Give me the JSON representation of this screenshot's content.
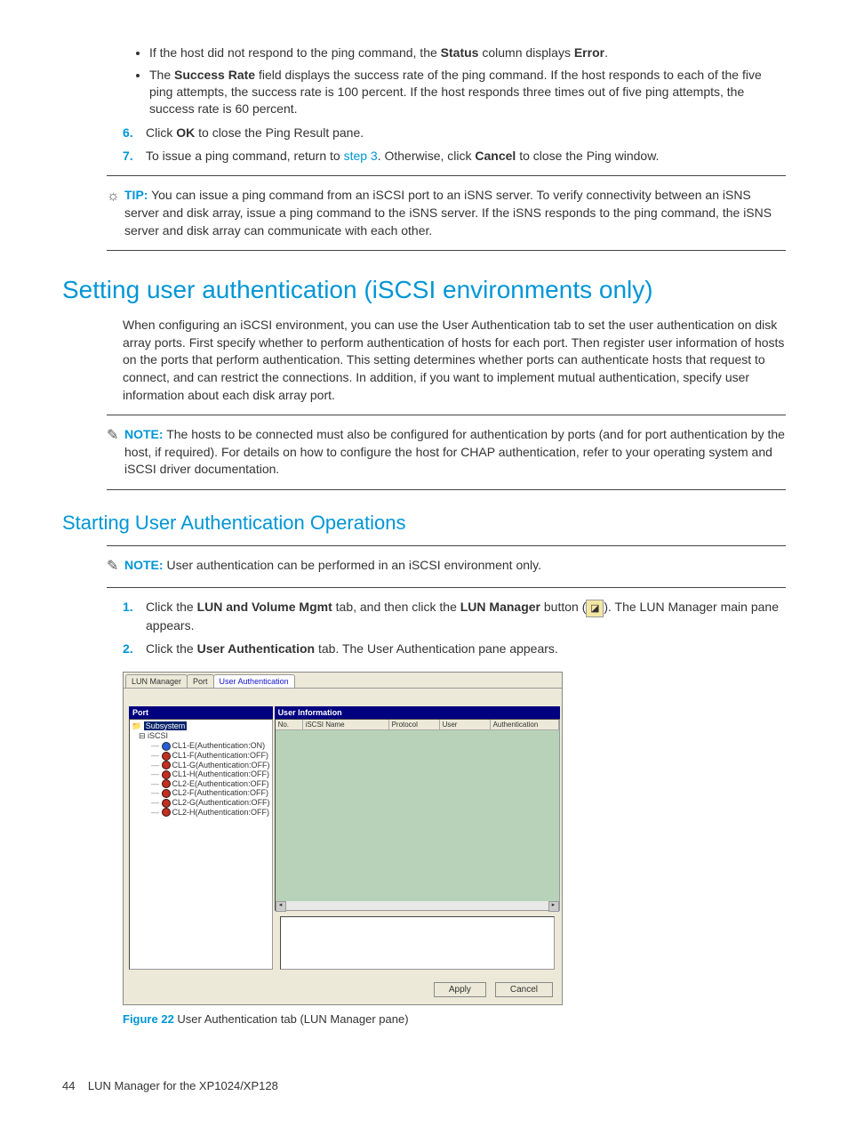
{
  "bullets": [
    {
      "pre": "If the host did not respond to the ping command, the ",
      "b1": "Status",
      "mid": " column displays ",
      "b2": "Error",
      "post": "."
    },
    {
      "pre": "The ",
      "b1": "Success Rate",
      "mid": "",
      "b2": "",
      "post": " field displays the success rate of the ping command. If the host responds to each of the five ping attempts, the success rate is 100 percent. If the host responds three times out of five ping attempts, the success rate is 60 percent."
    }
  ],
  "steps_top": [
    {
      "num": "6.",
      "pre": "Click ",
      "b1": "OK",
      "post": " to close the Ping Result pane."
    },
    {
      "num": "7.",
      "pre": "To issue a ping command, return to ",
      "link": "step 3",
      "mid": ". Otherwise, click ",
      "b1": "Cancel",
      "post": " to close the Ping window."
    }
  ],
  "tip": {
    "label": "TIP:",
    "text": "You can issue a ping command from an iSCSI port to an iSNS server. To verify connectivity between an iSNS server and disk array, issue a ping command to the iSNS server. If the iSNS responds to the ping command, the iSNS server and disk array can communicate with each other."
  },
  "heading1": "Setting user authentication (iSCSI environments only)",
  "para1": "When configuring an iSCSI environment, you can use the User Authentication tab to set the user authentication on disk array ports. First specify whether to perform authentication of hosts for each port. Then register user information of hosts on the ports that perform authentication. This setting determines whether ports can authenticate hosts that request to connect, and can restrict the connections. In addition, if you want to implement mutual authentication, specify user information about each disk array port.",
  "note1": {
    "label": "NOTE:",
    "text": "The hosts to be connected must also be configured for authentication by ports (and for port authentication by the host, if required). For details on how to configure the host for CHAP authentication, refer to your operating system and iSCSI driver documentation."
  },
  "heading2": "Starting User Authentication Operations",
  "note2": {
    "label": "NOTE:",
    "text": "User authentication can be performed in an iSCSI environment only."
  },
  "steps_main": [
    {
      "num": "1.",
      "pre": "Click the ",
      "b1": "LUN and Volume Mgmt",
      "mid": " tab, and then click the ",
      "b2": "LUN Manager",
      "post1": " button (",
      "post2": "). The LUN Manager main pane appears."
    },
    {
      "num": "2.",
      "pre": "Click the ",
      "b1": "User Authentication",
      "mid": " tab. The User Authentication pane appears.",
      "b2": "",
      "post1": "",
      "post2": ""
    }
  ],
  "figure": {
    "tabs": [
      "LUN Manager",
      "Port",
      "User Authentication"
    ],
    "active_tab_index": 2,
    "left_title": "Port",
    "right_title": "User Information",
    "tree": {
      "root": "Subsystem",
      "child": "iSCSI",
      "leaves": [
        {
          "name": "CL1-E(Authentication:ON)",
          "on": true
        },
        {
          "name": "CL1-F(Authentication:OFF)",
          "on": false
        },
        {
          "name": "CL1-G(Authentication:OFF)",
          "on": false
        },
        {
          "name": "CL1-H(Authentication:OFF)",
          "on": false
        },
        {
          "name": "CL2-E(Authentication:OFF)",
          "on": false
        },
        {
          "name": "CL2-F(Authentication:OFF)",
          "on": false
        },
        {
          "name": "CL2-G(Authentication:OFF)",
          "on": false
        },
        {
          "name": "CL2-H(Authentication:OFF)",
          "on": false
        }
      ]
    },
    "columns": [
      "No.",
      "iSCSI Name",
      "Protocol",
      "User",
      "Authentication"
    ],
    "buttons": [
      "Apply",
      "Cancel"
    ],
    "caption_num": "Figure 22",
    "caption_text": " User Authentication tab (LUN Manager pane)"
  },
  "footer": {
    "page": "44",
    "title": "LUN Manager for the XP1024/XP128"
  }
}
